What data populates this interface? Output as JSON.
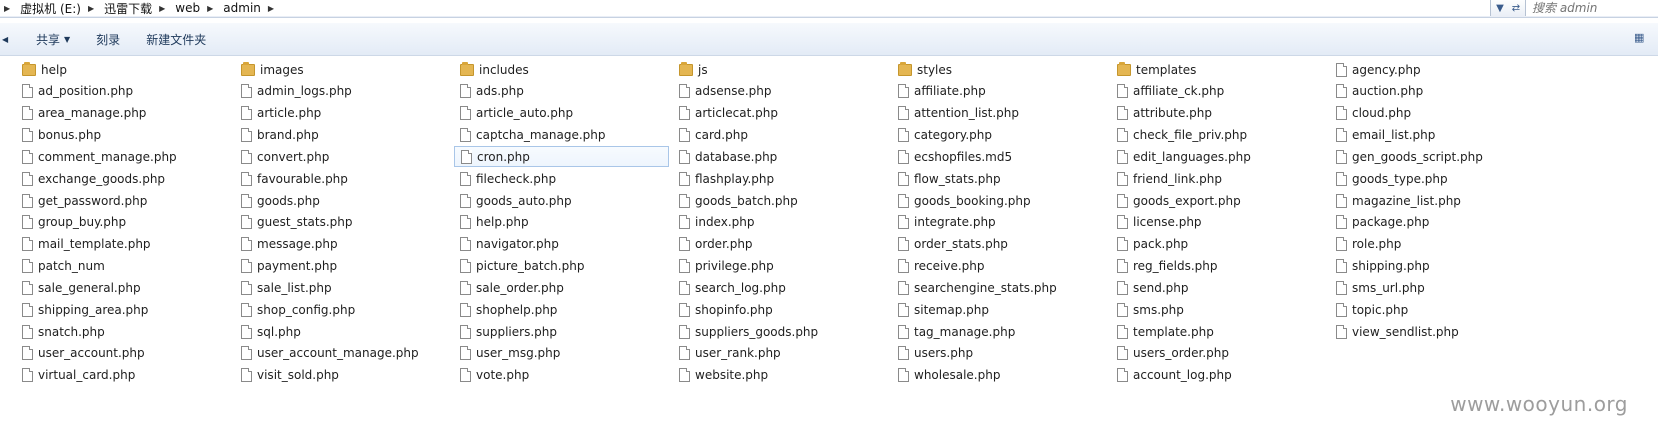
{
  "breadcrumb": [
    "虚拟机 (E:)",
    "迅雷下载",
    "web",
    "admin"
  ],
  "search": {
    "placeholder": "搜索 admin"
  },
  "toolbar": {
    "share": "共享",
    "burn": "刻录",
    "new_folder": "新建文件夹"
  },
  "selected_item": "cron.php",
  "files": [
    {
      "name": "help",
      "type": "folder"
    },
    {
      "name": "ad_position.php",
      "type": "file"
    },
    {
      "name": "area_manage.php",
      "type": "file"
    },
    {
      "name": "bonus.php",
      "type": "file"
    },
    {
      "name": "comment_manage.php",
      "type": "file"
    },
    {
      "name": "exchange_goods.php",
      "type": "file"
    },
    {
      "name": "get_password.php",
      "type": "file"
    },
    {
      "name": "group_buy.php",
      "type": "file"
    },
    {
      "name": "mail_template.php",
      "type": "file"
    },
    {
      "name": "patch_num",
      "type": "file"
    },
    {
      "name": "sale_general.php",
      "type": "file"
    },
    {
      "name": "shipping_area.php",
      "type": "file"
    },
    {
      "name": "snatch.php",
      "type": "file"
    },
    {
      "name": "user_account.php",
      "type": "file"
    },
    {
      "name": "virtual_card.php",
      "type": "file"
    },
    {
      "name": "images",
      "type": "folder"
    },
    {
      "name": "admin_logs.php",
      "type": "file"
    },
    {
      "name": "article.php",
      "type": "file"
    },
    {
      "name": "brand.php",
      "type": "file"
    },
    {
      "name": "convert.php",
      "type": "file"
    },
    {
      "name": "favourable.php",
      "type": "file"
    },
    {
      "name": "goods.php",
      "type": "file"
    },
    {
      "name": "guest_stats.php",
      "type": "file"
    },
    {
      "name": "message.php",
      "type": "file"
    },
    {
      "name": "payment.php",
      "type": "file"
    },
    {
      "name": "sale_list.php",
      "type": "file"
    },
    {
      "name": "shop_config.php",
      "type": "file"
    },
    {
      "name": "sql.php",
      "type": "file"
    },
    {
      "name": "user_account_manage.php",
      "type": "file"
    },
    {
      "name": "visit_sold.php",
      "type": "file"
    },
    {
      "name": "includes",
      "type": "folder"
    },
    {
      "name": "ads.php",
      "type": "file"
    },
    {
      "name": "article_auto.php",
      "type": "file"
    },
    {
      "name": "captcha_manage.php",
      "type": "file"
    },
    {
      "name": "cron.php",
      "type": "file"
    },
    {
      "name": "filecheck.php",
      "type": "file"
    },
    {
      "name": "goods_auto.php",
      "type": "file"
    },
    {
      "name": "help.php",
      "type": "file"
    },
    {
      "name": "navigator.php",
      "type": "file"
    },
    {
      "name": "picture_batch.php",
      "type": "file"
    },
    {
      "name": "sale_order.php",
      "type": "file"
    },
    {
      "name": "shophelp.php",
      "type": "file"
    },
    {
      "name": "suppliers.php",
      "type": "file"
    },
    {
      "name": "user_msg.php",
      "type": "file"
    },
    {
      "name": "vote.php",
      "type": "file"
    },
    {
      "name": "js",
      "type": "folder"
    },
    {
      "name": "adsense.php",
      "type": "file"
    },
    {
      "name": "articlecat.php",
      "type": "file"
    },
    {
      "name": "card.php",
      "type": "file"
    },
    {
      "name": "database.php",
      "type": "file"
    },
    {
      "name": "flashplay.php",
      "type": "file"
    },
    {
      "name": "goods_batch.php",
      "type": "file"
    },
    {
      "name": "index.php",
      "type": "file"
    },
    {
      "name": "order.php",
      "type": "file"
    },
    {
      "name": "privilege.php",
      "type": "file"
    },
    {
      "name": "search_log.php",
      "type": "file"
    },
    {
      "name": "shopinfo.php",
      "type": "file"
    },
    {
      "name": "suppliers_goods.php",
      "type": "file"
    },
    {
      "name": "user_rank.php",
      "type": "file"
    },
    {
      "name": "website.php",
      "type": "file"
    },
    {
      "name": "styles",
      "type": "folder"
    },
    {
      "name": "affiliate.php",
      "type": "file"
    },
    {
      "name": "attention_list.php",
      "type": "file"
    },
    {
      "name": "category.php",
      "type": "file"
    },
    {
      "name": "ecshopfiles.md5",
      "type": "file"
    },
    {
      "name": "flow_stats.php",
      "type": "file"
    },
    {
      "name": "goods_booking.php",
      "type": "file"
    },
    {
      "name": "integrate.php",
      "type": "file"
    },
    {
      "name": "order_stats.php",
      "type": "file"
    },
    {
      "name": "receive.php",
      "type": "file"
    },
    {
      "name": "searchengine_stats.php",
      "type": "file"
    },
    {
      "name": "sitemap.php",
      "type": "file"
    },
    {
      "name": "tag_manage.php",
      "type": "file"
    },
    {
      "name": "users.php",
      "type": "file"
    },
    {
      "name": "wholesale.php",
      "type": "file"
    },
    {
      "name": "templates",
      "type": "folder"
    },
    {
      "name": "affiliate_ck.php",
      "type": "file"
    },
    {
      "name": "attribute.php",
      "type": "file"
    },
    {
      "name": "check_file_priv.php",
      "type": "file"
    },
    {
      "name": "edit_languages.php",
      "type": "file"
    },
    {
      "name": "friend_link.php",
      "type": "file"
    },
    {
      "name": "goods_export.php",
      "type": "file"
    },
    {
      "name": "license.php",
      "type": "file"
    },
    {
      "name": "pack.php",
      "type": "file"
    },
    {
      "name": "reg_fields.php",
      "type": "file"
    },
    {
      "name": "send.php",
      "type": "file"
    },
    {
      "name": "sms.php",
      "type": "file"
    },
    {
      "name": "template.php",
      "type": "file"
    },
    {
      "name": "users_order.php",
      "type": "file"
    },
    {
      "name": "account_log.php",
      "type": "file"
    },
    {
      "name": "agency.php",
      "type": "file"
    },
    {
      "name": "auction.php",
      "type": "file"
    },
    {
      "name": "cloud.php",
      "type": "file"
    },
    {
      "name": "email_list.php",
      "type": "file"
    },
    {
      "name": "gen_goods_script.php",
      "type": "file"
    },
    {
      "name": "goods_type.php",
      "type": "file"
    },
    {
      "name": "magazine_list.php",
      "type": "file"
    },
    {
      "name": "package.php",
      "type": "file"
    },
    {
      "name": "role.php",
      "type": "file"
    },
    {
      "name": "shipping.php",
      "type": "file"
    },
    {
      "name": "sms_url.php",
      "type": "file"
    },
    {
      "name": "topic.php",
      "type": "file"
    },
    {
      "name": "view_sendlist.php",
      "type": "file"
    }
  ],
  "watermark": "www.wooyun.org"
}
